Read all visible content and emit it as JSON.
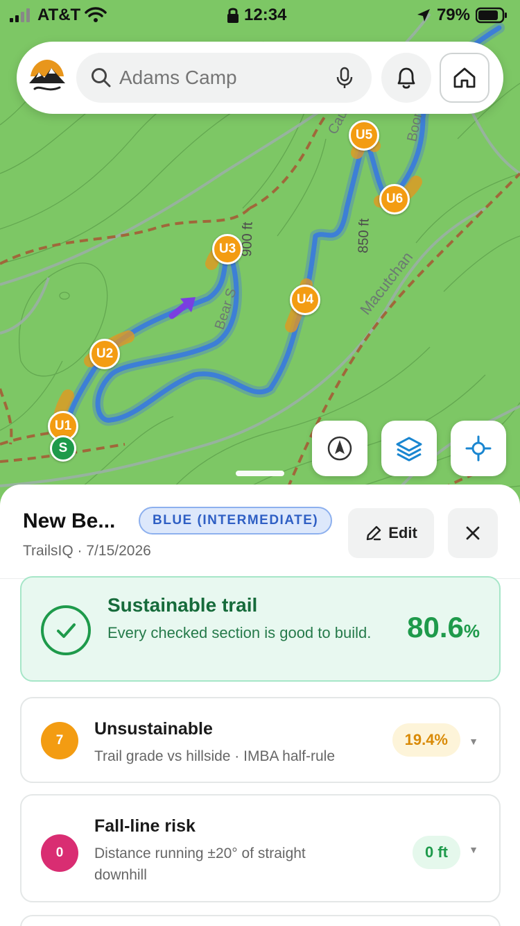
{
  "status_bar": {
    "carrier": "AT&T",
    "time": "12:34",
    "battery": "79%"
  },
  "search": {
    "placeholder": "Adams Camp"
  },
  "map": {
    "labels": {
      "contour_900": "900 ft",
      "contour_850": "850 ft",
      "road_macutchan": "Macutchan",
      "road_bear_s": "Bear S",
      "road_boone": "Boone",
      "road_cause": "Cau"
    },
    "markers": [
      "U1",
      "U2",
      "U3",
      "U4",
      "U5",
      "U6",
      "S"
    ]
  },
  "trail": {
    "title": "New Be...",
    "difficulty": "BLUE (INTERMEDIATE)",
    "subtitle": "TrailsIQ · 7/15/2026",
    "edit_label": "Edit"
  },
  "summary": {
    "heading": "Sustainable trail",
    "description": "Every checked section is good to build.",
    "percent_value": "80.6",
    "percent_sign": "%"
  },
  "unsustainable": {
    "count": "7",
    "heading": "Unsustainable",
    "description": "Trail grade vs hillside · IMBA half-rule",
    "value": "19.4%"
  },
  "fall_line": {
    "count": "0",
    "heading": "Fall-line risk",
    "description": "Distance running ±20° of straight downhill",
    "value": "0 ft"
  },
  "colors": {
    "map_green": "#7dc765",
    "trail_blue": "#3d7fd6",
    "warning_orange": "#f39c12",
    "success_green": "#1e9a4b",
    "danger_pink": "#d92d72"
  }
}
